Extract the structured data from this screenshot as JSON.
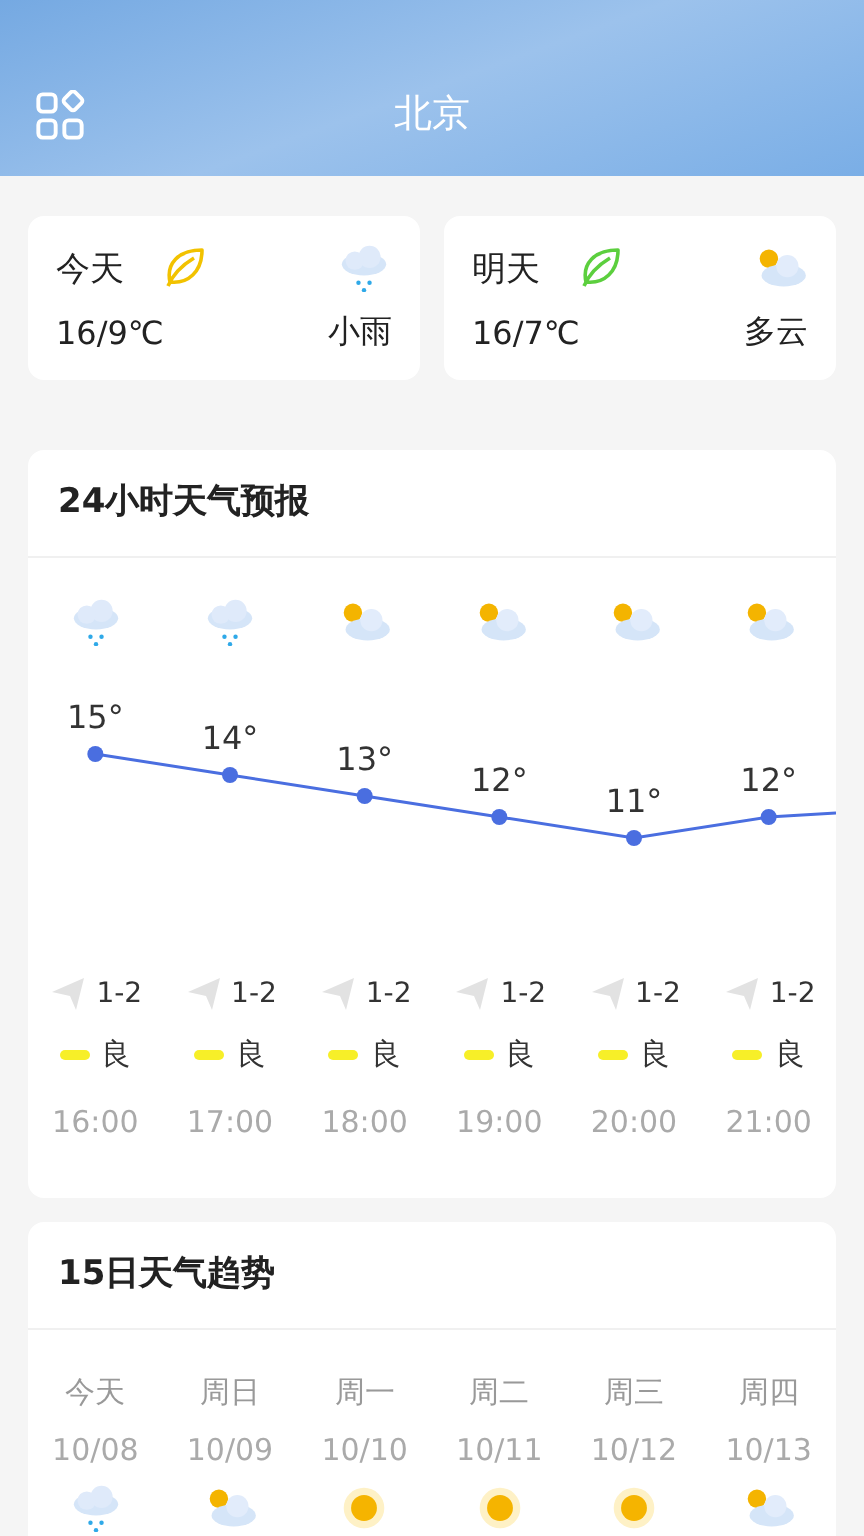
{
  "header": {
    "title": "北京"
  },
  "days": [
    {
      "label": "今天",
      "color": "#f2c200",
      "temp": "16/9℃",
      "weather": "小雨",
      "kind": "rain"
    },
    {
      "label": "明天",
      "color": "#5ccf3e",
      "temp": "16/7℃",
      "weather": "多云",
      "kind": "cloudy"
    }
  ],
  "hourly": {
    "title": "24小时天气预报",
    "hours": [
      {
        "kind": "rain",
        "temp": "15°",
        "wind": "1-2",
        "aqi": "良",
        "time": "16:00"
      },
      {
        "kind": "rain",
        "temp": "14°",
        "wind": "1-2",
        "aqi": "良",
        "time": "17:00"
      },
      {
        "kind": "cloudy",
        "temp": "13°",
        "wind": "1-2",
        "aqi": "良",
        "time": "18:00"
      },
      {
        "kind": "cloudy",
        "temp": "12°",
        "wind": "1-2",
        "aqi": "良",
        "time": "19:00"
      },
      {
        "kind": "cloudy",
        "temp": "11°",
        "wind": "1-2",
        "aqi": "良",
        "time": "20:00"
      },
      {
        "kind": "cloudy",
        "temp": "12°",
        "wind": "1-2",
        "aqi": "良",
        "time": "21:00"
      }
    ]
  },
  "trend": {
    "title": "15日天气趋势",
    "days": [
      {
        "weekday": "今天",
        "date": "10/08",
        "kind": "rain"
      },
      {
        "weekday": "周日",
        "date": "10/09",
        "kind": "cloudy"
      },
      {
        "weekday": "周一",
        "date": "10/10",
        "kind": "sunny"
      },
      {
        "weekday": "周二",
        "date": "10/11",
        "kind": "sunny"
      },
      {
        "weekday": "周三",
        "date": "10/12",
        "kind": "sunny"
      },
      {
        "weekday": "周四",
        "date": "10/13",
        "kind": "cloudy"
      }
    ]
  }
}
